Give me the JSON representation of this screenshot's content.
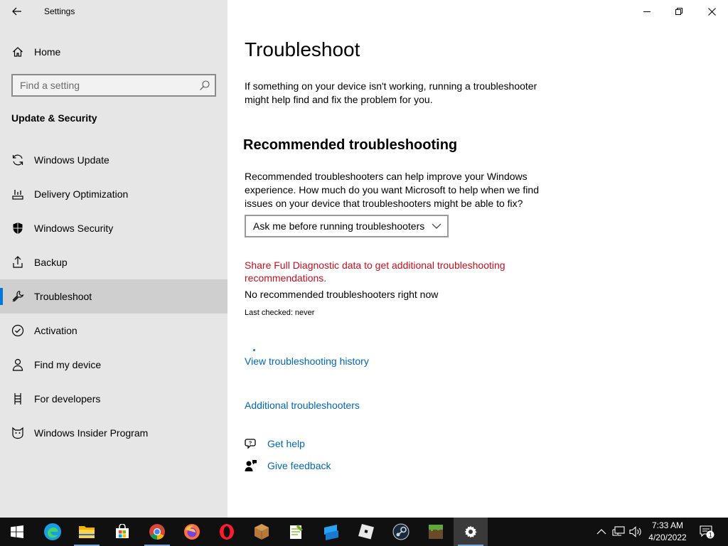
{
  "window": {
    "app_title": "Settings",
    "controls": [
      "minimize",
      "restore",
      "close"
    ]
  },
  "sidebar": {
    "home_label": "Home",
    "search_placeholder": "Find a setting",
    "section_title": "Update & Security",
    "items": [
      {
        "label": "Windows Update",
        "icon": "sync-icon"
      },
      {
        "label": "Delivery Optimization",
        "icon": "delivery-optimization-icon"
      },
      {
        "label": "Windows Security",
        "icon": "shield-icon"
      },
      {
        "label": "Backup",
        "icon": "backup-icon"
      },
      {
        "label": "Troubleshoot",
        "icon": "wrench-icon",
        "active": true
      },
      {
        "label": "Activation",
        "icon": "checkmark-circle-icon"
      },
      {
        "label": "Find my device",
        "icon": "person-location-icon"
      },
      {
        "label": "For developers",
        "icon": "developer-tools-icon"
      },
      {
        "label": "Windows Insider Program",
        "icon": "insider-cat-icon"
      }
    ]
  },
  "main": {
    "title": "Troubleshoot",
    "intro": "If something on your device isn't working, running a troubleshooter might help find and fix the problem for you.",
    "recommended_heading": "Recommended troubleshooting",
    "recommended_description": "Recommended troubleshooters can help improve your Windows experience. How much do you want Microsoft to help when we find issues on your device that troubleshooters might be able to fix?",
    "dropdown_value": "Ask me before running troubleshooters",
    "diagnostic_warning": "Share Full Diagnostic data to get additional troubleshooting recommendations.",
    "no_recommended": "No recommended troubleshooters right now",
    "last_checked": "Last checked: never",
    "history_link": "View troubleshooting history",
    "additional_link": "Additional troubleshooters",
    "get_help": "Get help",
    "give_feedback": "Give feedback",
    "colors": {
      "accent": "#0078d7",
      "link": "#0067b8",
      "warning": "#c50f1f"
    }
  },
  "taskbar": {
    "apps": [
      "start-icon",
      "edge-icon",
      "file-explorer-icon",
      "microsoft-store-icon",
      "chrome-icon",
      "firefox-icon",
      "opera-icon",
      "minecraft-launcher-icon",
      "notepad-plus-plus-icon",
      "mobile-app-icon",
      "roblox-icon",
      "steam-icon",
      "minecraft-icon",
      "settings-icon"
    ],
    "time": "7:33 AM",
    "date": "4/20/2022",
    "notification_count": "1"
  }
}
